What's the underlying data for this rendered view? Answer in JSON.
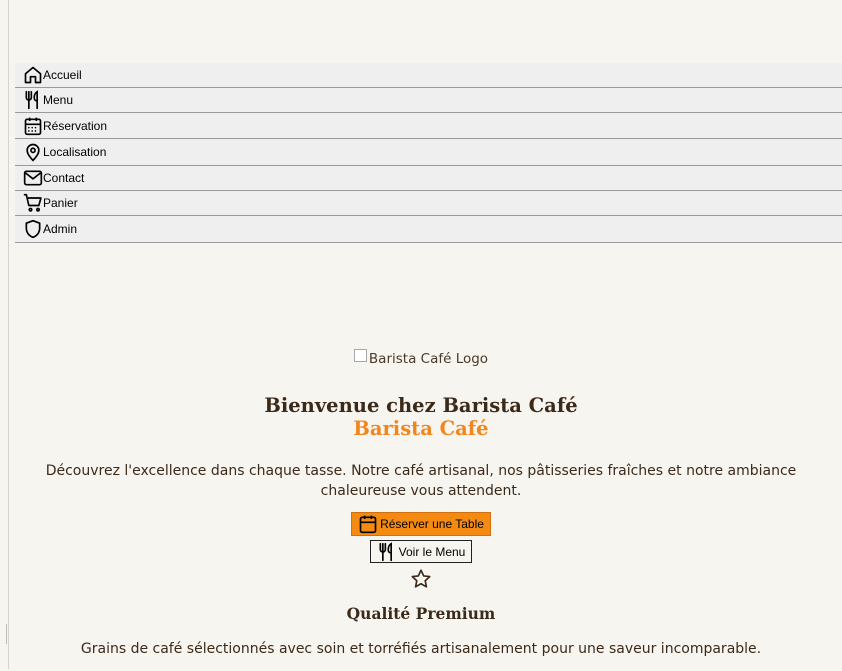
{
  "nav": {
    "items": [
      {
        "label": "Accueil",
        "icon": "home-icon"
      },
      {
        "label": "Menu",
        "icon": "utensils-icon"
      },
      {
        "label": "Réservation",
        "icon": "calendar-icon"
      },
      {
        "label": "Localisation",
        "icon": "map-pin-icon"
      },
      {
        "label": "Contact",
        "icon": "mail-icon"
      },
      {
        "label": "Panier",
        "icon": "cart-icon"
      },
      {
        "label": "Admin",
        "icon": "shield-icon"
      }
    ]
  },
  "hero": {
    "logo_alt": "Barista Café Logo",
    "title": "Bienvenue chez Barista Café",
    "subtitle": "Barista Café",
    "intro": "Découvrez l'excellence dans chaque tasse. Notre café artisanal, nos pâtisseries fraîches et notre ambiance chaleureuse vous attendent.",
    "primary_button": "Réserver une Table",
    "secondary_button": "Voir le Menu"
  },
  "feature": {
    "icon": "star-icon",
    "title": "Qualité Premium",
    "description": "Grains de café sélectionnés avec soin et torréfiés artisanalement pour une saveur incomparable."
  },
  "colors": {
    "background": "#f7f5f0",
    "accent": "#f58a12",
    "text": "#3b2a1a"
  }
}
